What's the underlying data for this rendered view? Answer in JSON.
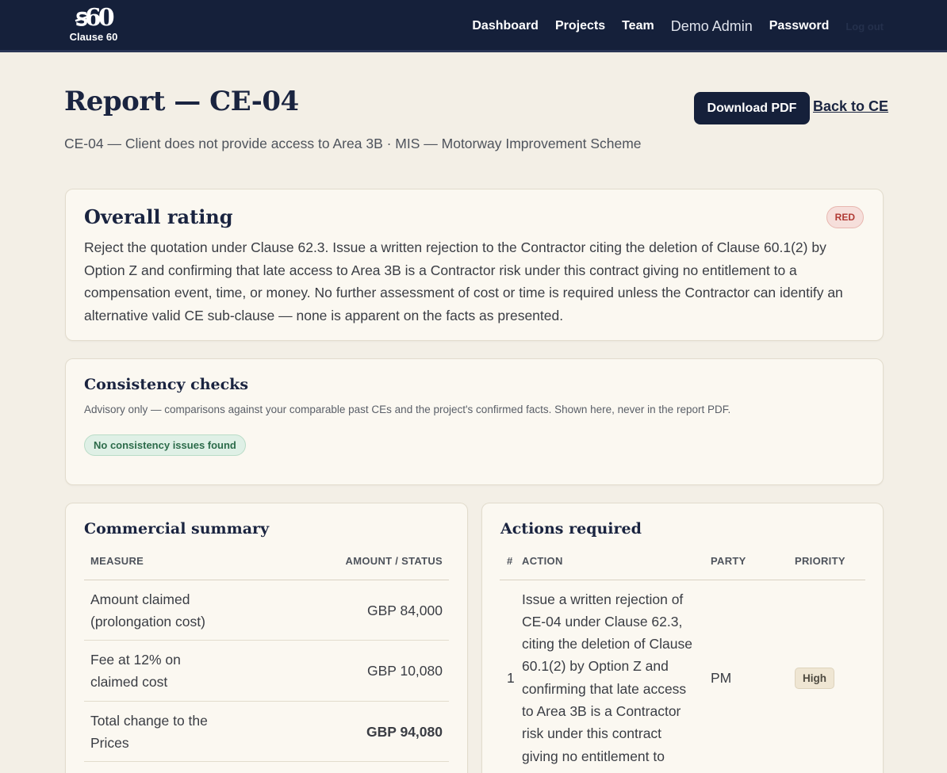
{
  "app": {
    "logo_mark": "ꞩ60",
    "logo_text": "Clause 60"
  },
  "nav": {
    "dashboard": "Dashboard",
    "projects": "Projects",
    "team": "Team",
    "user": "Demo Admin",
    "password": "Password",
    "logout": "Log out"
  },
  "page": {
    "title": "Report — CE-04",
    "subtitle": "CE-04 — Client does not provide access to Area 3B · MIS — Motorway Improvement Scheme",
    "download_label": "Download PDF",
    "back_label": "Back to CE"
  },
  "rating": {
    "heading": "Overall rating",
    "badge": "RED",
    "text": "Reject the quotation under Clause 62.3. Issue a written rejection to the Contractor citing the deletion of Clause 60.1(2) by Option Z and confirming that late access to Area 3B is a Contractor risk under this contract giving no entitlement to a compensation event, time, or money. No further assessment of cost or time is required unless the Contractor can identify an alternative valid CE sub-clause — none is apparent on the facts as presented."
  },
  "consistency": {
    "heading": "Consistency checks",
    "advisory": "Advisory only — comparisons against your comparable past CEs and the project's confirmed facts. Shown here, never in the report PDF.",
    "status": "No consistency issues found"
  },
  "commercial": {
    "heading": "Commercial summary",
    "col_measure": "MEASURE",
    "col_amount": "AMOUNT / STATUS",
    "rows": [
      {
        "measure": "Amount claimed (prolongation cost)",
        "amount": "GBP 84,000"
      },
      {
        "measure": "Fee at 12% on claimed cost",
        "amount": "GBP 10,080"
      },
      {
        "measure": "Total change to the Prices",
        "amount": "GBP 94,080"
      }
    ]
  },
  "actions": {
    "heading": "Actions required",
    "col_num": "#",
    "col_action": "ACTION",
    "col_party": "PARTY",
    "col_priority": "PRIORITY",
    "rows": [
      {
        "num": "1",
        "action": "Issue a written rejection of CE-04 under Clause 62.3, citing the deletion of Clause 60.1(2) by Option Z and confirming that late access to Area 3B is a Contractor risk under this contract giving no entitlement to",
        "party": "PM",
        "priority": "High"
      }
    ]
  },
  "colors": {
    "navy": "#15203a",
    "background": "#f3efe6",
    "card": "#fbf8f1",
    "red_badge": "#b03a34",
    "green_badge": "#2c6b4a"
  }
}
